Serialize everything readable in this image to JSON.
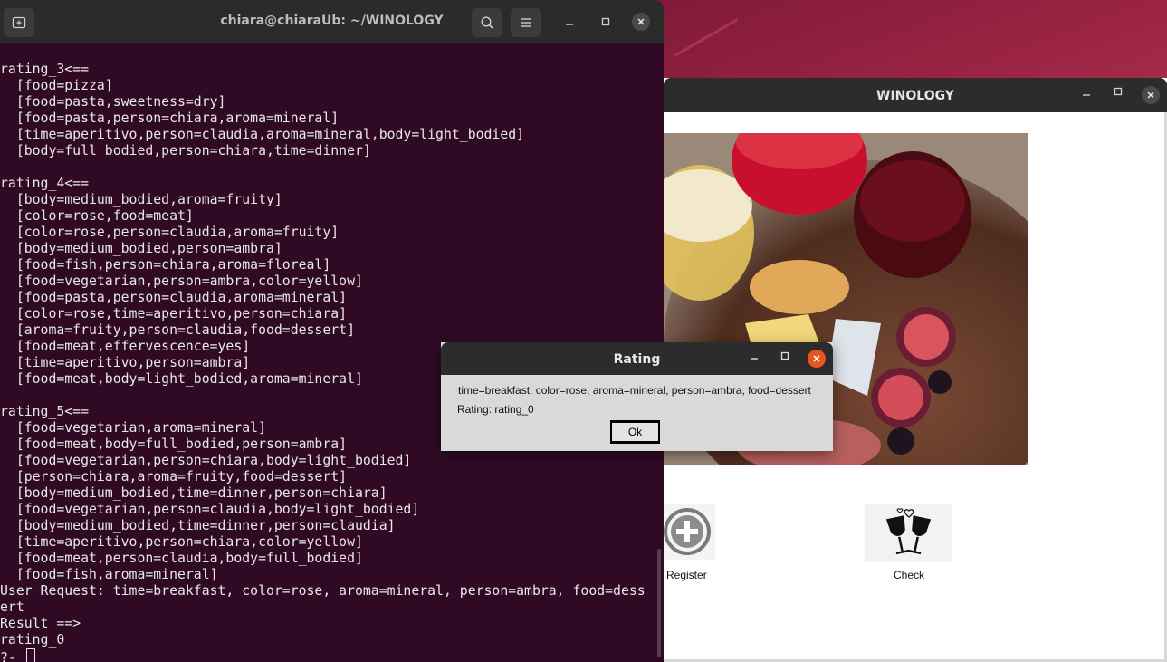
{
  "terminal": {
    "title": "chiara@chiaraUb: ~/WINOLOGY",
    "lines": [
      "rating_3<==",
      "  [food=pizza]",
      "  [food=pasta,sweetness=dry]",
      "  [food=pasta,person=chiara,aroma=mineral]",
      "  [time=aperitivo,person=claudia,aroma=mineral,body=light_bodied]",
      "  [body=full_bodied,person=chiara,time=dinner]",
      "",
      "rating_4<==",
      "  [body=medium_bodied,aroma=fruity]",
      "  [color=rose,food=meat]",
      "  [color=rose,person=claudia,aroma=fruity]",
      "  [body=medium_bodied,person=ambra]",
      "  [food=fish,person=chiara,aroma=floreal]",
      "  [food=vegetarian,person=ambra,color=yellow]",
      "  [food=pasta,person=claudia,aroma=mineral]",
      "  [color=rose,time=aperitivo,person=chiara]",
      "  [aroma=fruity,person=claudia,food=dessert]",
      "  [food=meat,effervescence=yes]",
      "  [time=aperitivo,person=ambra]",
      "  [food=meat,body=light_bodied,aroma=mineral]",
      "",
      "rating_5<==",
      "  [food=vegetarian,aroma=mineral]",
      "  [food=meat,body=full_bodied,person=ambra]",
      "  [food=vegetarian,person=chiara,body=light_bodied]",
      "  [person=chiara,aroma=fruity,food=dessert]",
      "  [body=medium_bodied,time=dinner,person=chiara]",
      "  [food=vegetarian,person=claudia,body=light_bodied]",
      "  [body=medium_bodied,time=dinner,person=claudia]",
      "  [time=aperitivo,person=chiara,color=yellow]",
      "  [food=meat,person=claudia,body=full_bodied]",
      "  [food=fish,aroma=mineral]",
      "User Request: time=breakfast, color=rose, aroma=mineral, person=ambra, food=dess",
      "ert",
      "Result ==>",
      "rating_0"
    ],
    "prompt": "?- "
  },
  "winology": {
    "title": "WINOLOGY",
    "register_label": "Register",
    "check_label": "Check"
  },
  "dialog": {
    "title": "Rating",
    "request_text": "time=breakfast, color=rose, aroma=mineral, person=ambra, food=dessert",
    "rating_text": "Rating: rating_0",
    "ok_label": "Ok"
  },
  "icons": {
    "new_tab": "new-tab-icon",
    "search": "search-icon",
    "menu": "hamburger-menu-icon",
    "minimize": "minimize-icon",
    "maximize": "maximize-icon",
    "close": "close-icon",
    "register": "plus-circle-icon",
    "check": "wine-glasses-toast-icon"
  },
  "colors": {
    "terminal_bg": "#300a24",
    "titlebar_bg": "#2c2c2c",
    "close_accent": "#e95420",
    "dialog_bg": "#d9d9d9"
  }
}
